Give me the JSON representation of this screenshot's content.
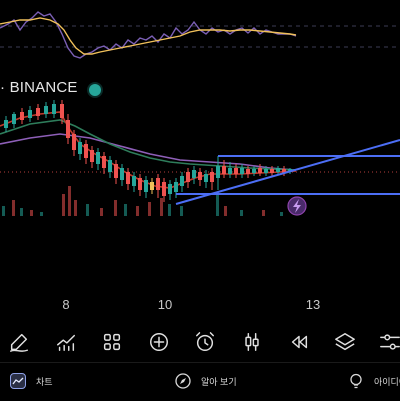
{
  "chart": {
    "symbol_label": "· BINANCE",
    "date_labels": [
      "8",
      "10",
      "13"
    ],
    "colors": {
      "up": "#26a69a",
      "down": "#ef5350",
      "trendline": "#4c6ef5",
      "indicator_line": "#7b5fb5",
      "signal_line": "#f0c05a",
      "status_dot": "#26a69a",
      "alert_badge": "#8e44ad"
    },
    "icons": {
      "alert": "lightning-icon"
    }
  },
  "toolbar": {
    "tools": [
      {
        "name": "draw-pen-icon"
      },
      {
        "name": "indicators-icon"
      },
      {
        "name": "layout-grid-icon"
      },
      {
        "name": "add-icon"
      },
      {
        "name": "alarm-clock-icon"
      },
      {
        "name": "chart-type-candles-icon"
      },
      {
        "name": "replay-rewind-icon"
      },
      {
        "name": "layers-icon"
      },
      {
        "name": "settings-sliders-icon"
      }
    ]
  },
  "bottom_nav": {
    "chart_label": "차트",
    "explore_label": "알아 보기",
    "ideas_label": "아이디어"
  }
}
